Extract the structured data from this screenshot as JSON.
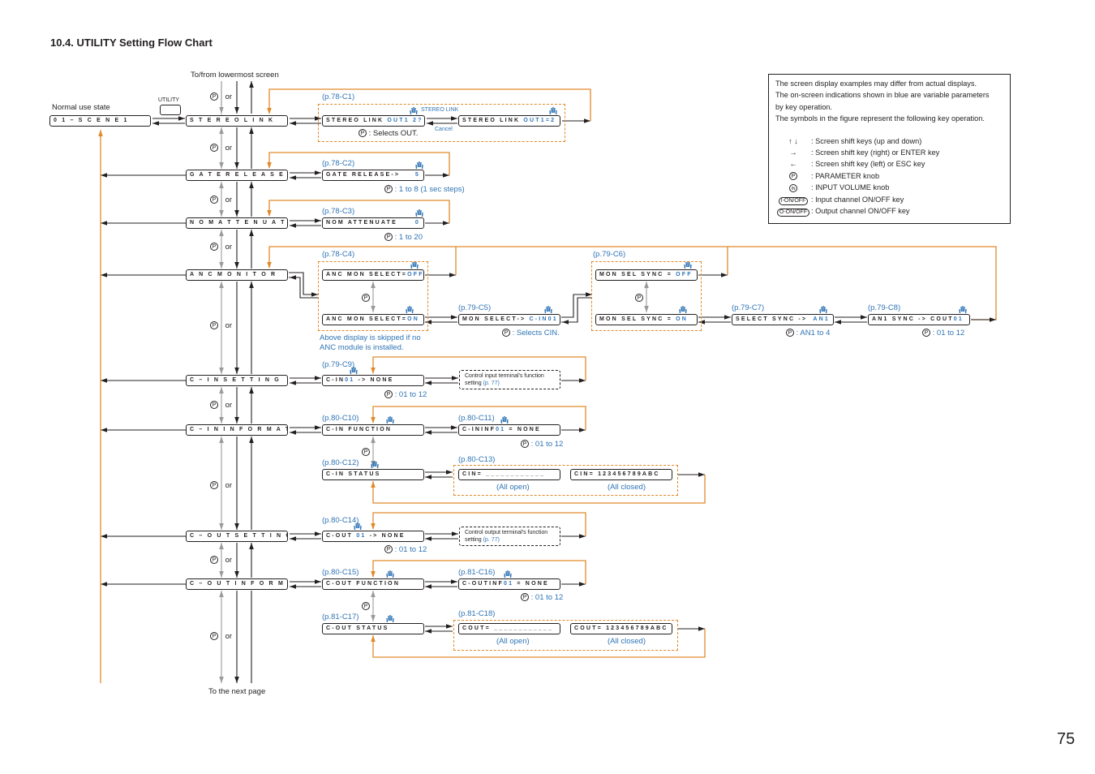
{
  "page": {
    "title": "10.4. UTILITY Setting Flow Chart",
    "page_number": "75"
  },
  "labels": {
    "to_from_lowermost": "To/from lowermost screen",
    "normal_use_state": "Normal use state",
    "utility_key": "UTILITY",
    "to_next_page": "To the next page",
    "or": "or",
    "p_symbol": "P"
  },
  "main_screens": [
    {
      "id": "scene",
      "text": "0 1 – S C E N E 1"
    },
    {
      "id": "stereo_link",
      "text": "S T E R E O   L I N K"
    },
    {
      "id": "gate_release",
      "text": "G A T E   R E L E A S E T I M E"
    },
    {
      "id": "nom_attenuate",
      "text": "N O M   A T T E N U A T E"
    },
    {
      "id": "anc_monitor",
      "text": "A N C  M O N I T O R"
    },
    {
      "id": "cin_setting",
      "text": "C – I N   S E T T I N G"
    },
    {
      "id": "cin_information",
      "text": "C – I N   I N F O R M A T I O N"
    },
    {
      "id": "cout_setting",
      "text": "C – O U T   S E T T I N G"
    },
    {
      "id": "cout_information",
      "text": "C – O U T   I N F O R M A T I O N"
    }
  ],
  "sub_screens": {
    "c1a": {
      "ref": "(p.78-C1)",
      "text": "STEREO LINK ",
      "value": "OUT1 2?",
      "note": ": Selects OUT."
    },
    "c1b": {
      "text": "STEREO LINK ",
      "value": "OUT1=2"
    },
    "c1_fwd": "STEREO LINK",
    "c1_back": "Cancel",
    "c2": {
      "ref": "(p.78-C2)",
      "text": "GATE RELEASE->",
      "value": "5",
      "note": ": 1 to 8 (1 sec steps)"
    },
    "c3": {
      "ref": "(p.78-C3)",
      "text": "NOM ATTENUATE",
      "value": "0",
      "note": ": 1 to 20"
    },
    "c4a": {
      "ref": "(p.78-C4)",
      "text": "ANC MON SELECT=",
      "value": "OFF"
    },
    "c4b": {
      "text": "ANC MON SELECT=",
      "value": "ON"
    },
    "c4_note": [
      "Above display is skipped if no",
      "ANC module is installed."
    ],
    "c5": {
      "ref": "(p.79-C5)",
      "text": "MON SELECT-> ",
      "value": "C-IN01",
      "note": ": Selects CIN."
    },
    "c6a": {
      "ref": "(p.79-C6)",
      "text": "MON SEL SYNC = ",
      "value": "OFF"
    },
    "c6b": {
      "text": "MON SEL SYNC = ",
      "value": "ON"
    },
    "c7": {
      "ref": "(p.79-C7)",
      "text": "SELECT SYNC -> ",
      "value": "AN1",
      "note": ": AN1 to 4"
    },
    "c8": {
      "ref": "(p.79-C8)",
      "text": "AN1 SYNC -> COUT",
      "value": "01",
      "note": ": 01 to 12"
    },
    "c9": {
      "ref": "(p.79-C9)",
      "text": "C-IN",
      "value": "01",
      "tail": "  ->  NONE",
      "note": ": 01 to 12"
    },
    "c9_box": {
      "line1": "Control input terminal's function",
      "line2": "setting ",
      "link": "(p. 77)"
    },
    "c10": {
      "ref": "(p.80-C10)",
      "text": "C-IN      FUNCTION"
    },
    "c11": {
      "ref": "(p.80-C11)",
      "text": "C-ININF",
      "value": "01",
      "tail": "  =  NONE",
      "note": ": 01 to 12"
    },
    "c12": {
      "ref": "(p.80-C12)",
      "text": "C-IN       STATUS"
    },
    "c13": {
      "ref": "(p.80-C13)",
      "open": "CIN=  ____________",
      "closed": "CIN=  123456789ABC",
      "open_label": "(All open)",
      "closed_label": "(All closed)"
    },
    "c14": {
      "ref": "(p.80-C14)",
      "text": "C-OUT ",
      "value": "01",
      "tail": "  ->  NONE",
      "note": ": 01 to 12"
    },
    "c14_box": {
      "line1": "Control output terminal's function",
      "line2": "setting ",
      "link": "(p. 77)"
    },
    "c15": {
      "ref": "(p.80-C15)",
      "text": "C-OUT     FUNCTION"
    },
    "c16": {
      "ref": "(p.81-C16)",
      "text": "C-OUTINF",
      "value": "01",
      "tail": "  =  NONE",
      "note": ": 01 to 12"
    },
    "c17": {
      "ref": "(p.81-C17)",
      "text": "C-OUT      STATUS"
    },
    "c18": {
      "ref": "(p.81-C18)",
      "open": "COUT=  ____________",
      "closed": "COUT=  123456789ABC",
      "open_label": "(All open)",
      "closed_label": "(All closed)"
    }
  },
  "legend": {
    "intro": [
      "The screen display examples may differ from actual displays.",
      "The on-screen indications shown in blue are variable parameters",
      "by key operation.",
      "The symbols in the figure represent the following key operation."
    ],
    "items": [
      {
        "icon": "up-down-arrows-icon",
        "symbol": "↑  ↓",
        "text": ": Screen shift keys (up and down)"
      },
      {
        "icon": "right-arrow-icon",
        "symbol": "→",
        "text": ": Screen shift key (right) or ENTER key"
      },
      {
        "icon": "left-arrow-icon",
        "symbol": "←",
        "text": ": Screen shift key (left) or ESC key"
      },
      {
        "icon": "parameter-knob-icon",
        "symbol": "P",
        "text": ": PARAMETER knob"
      },
      {
        "icon": "input-volume-knob-icon",
        "symbol": "IN",
        "text": ": INPUT VOLUME knob"
      },
      {
        "icon": "input-on-off-key-icon",
        "symbol": "I-ON/OFF",
        "text": ": Input channel ON/OFF key"
      },
      {
        "icon": "output-on-off-key-icon",
        "symbol": "O-ON/OFF",
        "text": ": Output channel ON/OFF key"
      }
    ]
  },
  "colors": {
    "accent_orange": "#e08a2c",
    "variable_blue": "#2f74b5",
    "gray_arrow": "#9a9a9a"
  }
}
